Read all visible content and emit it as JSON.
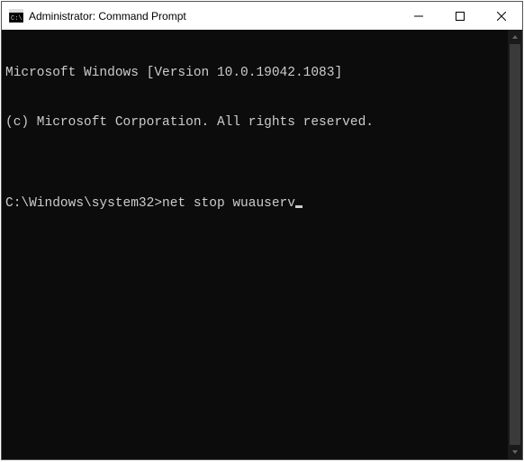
{
  "window": {
    "title": "Administrator: Command Prompt"
  },
  "terminal": {
    "line1": "Microsoft Windows [Version 10.0.19042.1083]",
    "line2": "(c) Microsoft Corporation. All rights reserved.",
    "blank": "",
    "prompt": "C:\\Windows\\system32>",
    "command": "net stop wuauserv"
  }
}
